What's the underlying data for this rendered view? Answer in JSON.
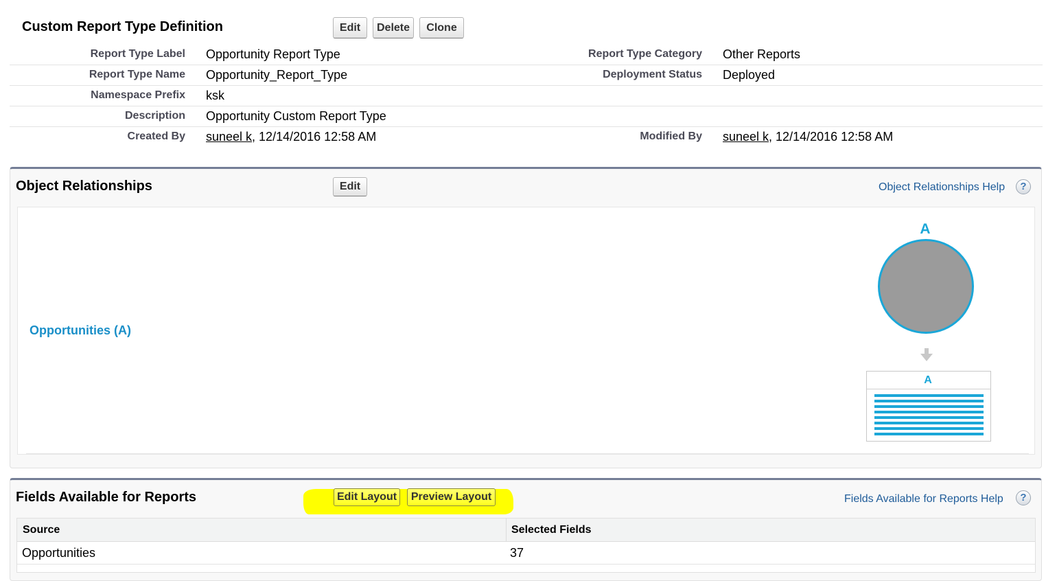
{
  "definition": {
    "title": "Custom Report Type Definition",
    "buttons": {
      "edit": "Edit",
      "delete": "Delete",
      "clone": "Clone"
    },
    "fields": {
      "report_type_label": {
        "label": "Report Type Label",
        "value": "Opportunity Report Type"
      },
      "report_type_name": {
        "label": "Report Type Name",
        "value": "Opportunity_Report_Type"
      },
      "namespace_prefix": {
        "label": "Namespace Prefix",
        "value": "ksk"
      },
      "description": {
        "label": "Description",
        "value": "Opportunity Custom Report Type"
      },
      "created_by": {
        "label": "Created By",
        "user": "suneel k",
        "rest": ", 12/14/2016 12:58 AM"
      },
      "report_type_category": {
        "label": "Report Type Category",
        "value": "Other Reports"
      },
      "deployment_status": {
        "label": "Deployment Status",
        "value": "Deployed"
      },
      "modified_by": {
        "label": "Modified By",
        "user": "suneel k",
        "rest": ", 12/14/2016 12:58 AM"
      }
    }
  },
  "object_relationships": {
    "title": "Object Relationships",
    "edit_label": "Edit",
    "help_label": "Object Relationships Help",
    "help_icon": "?",
    "object_link": "Opportunities (A)",
    "diagram": {
      "circle_letter": "A",
      "table_letter": "A",
      "circle_color": "#9b9b9b",
      "accent_color": "#1ba7d8"
    }
  },
  "fields_available": {
    "title": "Fields Available for Reports",
    "edit_layout_label": "Edit Layout",
    "preview_layout_label": "Preview Layout",
    "help_label": "Fields Available for Reports Help",
    "help_icon": "?",
    "highlight_color": "#ffff00",
    "columns": [
      "Source",
      "Selected Fields"
    ],
    "rows": [
      {
        "source": "Opportunities",
        "selected_fields": "37"
      }
    ]
  }
}
